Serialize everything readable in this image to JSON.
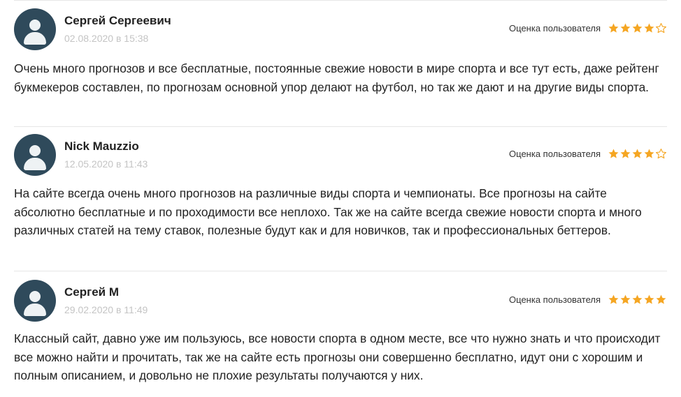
{
  "reviews": [
    {
      "author": "Сергей Сергеевич",
      "date": "02.08.2020 в 15:38",
      "rating_label": "Оценка пользователя",
      "rating": 4,
      "text": "Очень много прогнозов и все бесплатные, постоянные свежие новости в мире спорта и все тут есть, даже рейтенг букмекеров составлен, по прогнозам основной упор делают на футбол, но так же дают и на другие виды спорта."
    },
    {
      "author": "Nick Mauzzio",
      "date": "12.05.2020 в 11:43",
      "rating_label": "Оценка пользователя",
      "rating": 4,
      "text": "На сайте всегда очень много прогнозов на различные виды спорта и чемпионаты. Все прогнозы на сайте абсолютно бесплатные и по проходимости все неплохо. Так же на сайте всегда свежие новости спорта и много различных статей на тему ставок, полезные будут как и для новичков, так и профессиональных беттеров."
    },
    {
      "author": "Сергей М",
      "date": "29.02.2020 в 11:49",
      "rating_label": "Оценка пользователя",
      "rating": 5,
      "text": "Классный сайт, давно уже им пользуюсь, все новости спорта в одном месте, все что нужно знать и что происходит все можно найти и прочитать, так же на сайте есть прогнозы они совершенно бесплатно, идут они с хорошим и полным описанием, и довольно не плохие результаты получаются у них."
    }
  ],
  "colors": {
    "star_filled": "#f5a623",
    "star_empty_outline": "#f5a623",
    "avatar_bg": "#2f4a5b",
    "date_text": "#c4c4c4"
  }
}
